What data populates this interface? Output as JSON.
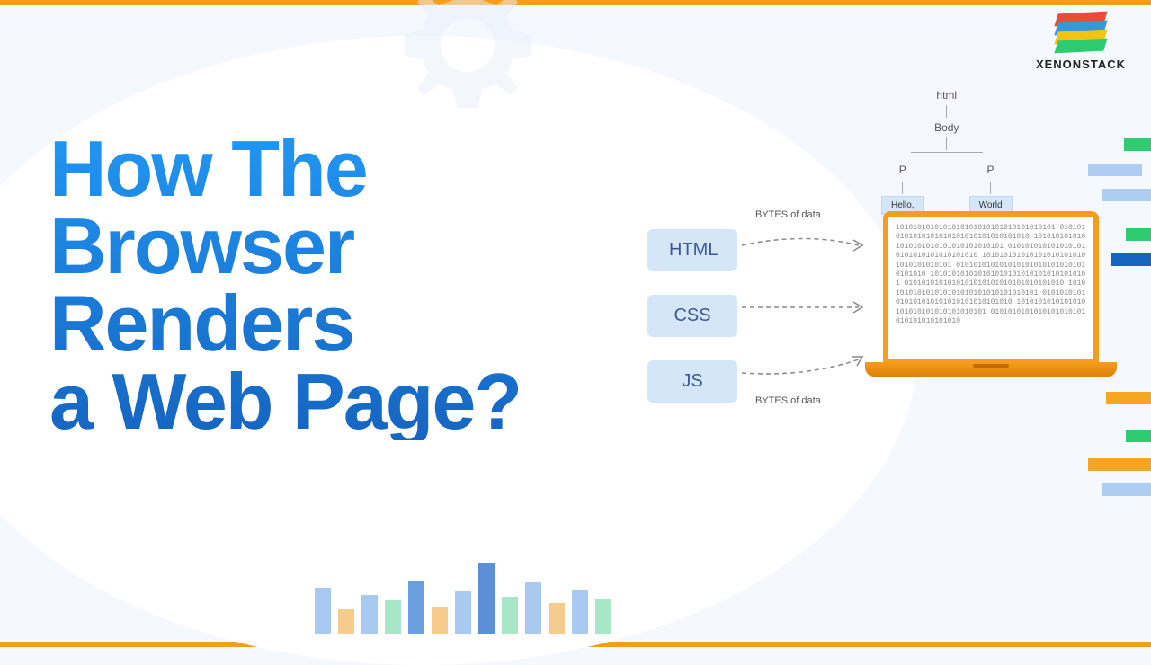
{
  "brand": {
    "name": "XENONSTACK"
  },
  "title": {
    "line1": "How The",
    "line2": "Browser",
    "line3": "Renders",
    "line4": "a Web Page?"
  },
  "diagram": {
    "tree": {
      "root": "html",
      "body": "Body",
      "p1": "P",
      "p2": "P",
      "leaf1": "Hello,",
      "leaf2": "World"
    },
    "sources": {
      "html": "HTML",
      "css": "CSS",
      "js": "JS"
    },
    "bytes_label": "BYTES of data",
    "binary_sample": "1010101010101010101010101010101010101 0101010101010101010101010101010101010 1010101010101010101010101010101010101 0101010101010101010101010101010101010 1010101010101010101010101010101010101 0101010101010101010101010101010101010 1010101010101010101010101010101010101 0101010101010101010101010101010101010 1010101010101010101010101010101010101 0101010101010101010101010101010101010 1010101010101010101010101010101010101 0101010101010101010101010101010101010"
  }
}
